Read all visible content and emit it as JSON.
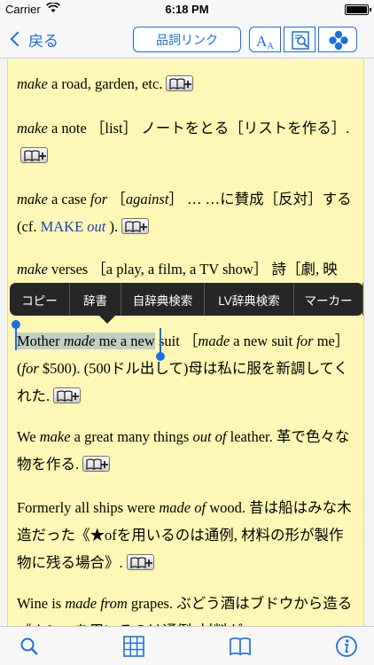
{
  "status_bar": {
    "carrier": "Carrier",
    "time": "6:18 PM"
  },
  "nav": {
    "back_label": "戻る",
    "pos_link_label": "品詞リンク",
    "font_icon": "font-size-icon",
    "search_icon": "search-in-page-icon",
    "menu_icon": "four-circles-icon"
  },
  "entries": {
    "e1": {
      "text": "a road, garden, etc.",
      "headword": "make"
    },
    "e2": {
      "headword": "make",
      "text": "a note ［list］ ノートをとる［リストを作る］."
    },
    "e3": {
      "headword": "make",
      "middle": "a case",
      "for": "for",
      "against": "against",
      "rest": "… …に賛成［反対］する (cf.",
      "ref": "MAKE",
      "ref_italic": "out",
      "end": ")."
    },
    "e4": {
      "headword": "make",
      "text": "verses ［a play, a film, a TV show］ 詩［劇, 映"
    },
    "e5": {
      "sel_start": "Mother",
      "sel_made": "made",
      "sel_rest": "me a new",
      "after_sel": "suit ［",
      "bracket_made": "made",
      "bracket_rest": "a new suit",
      "bracket_for": "for",
      "line2_start": "me］ (",
      "for2": "for",
      "line2_rest": "$500). (500ドル出して)母は私に服を新調してくれた."
    },
    "e6": {
      "start": "We",
      "make": "make",
      "mid": "a great many things",
      "outof": "out of",
      "end": "leather. 革で色々な物を作る."
    },
    "e7": {
      "start": "Formerly all ships were",
      "madeof": "made of",
      "end": "wood. 昔は船はみな木造だった《★ofを用いるのは通例, 材料の形が製作物に残る場合》."
    },
    "e8": {
      "start": "Wine is",
      "madefrom": "made from",
      "end": "grapes. ぶどう酒はブドウから造る《★fromを用いるのは通例, 材料が"
    }
  },
  "context_menu": {
    "items": [
      "コピー",
      "辞書",
      "自辞典検索",
      "LV辞典検索",
      "マーカー"
    ]
  },
  "tab_bar": {
    "icons": [
      "search-icon",
      "grid-icon",
      "book-icon",
      "info-icon"
    ]
  },
  "colors": {
    "accent": "#1a6fe0",
    "paper": "#fff7b5",
    "menu": "#262626",
    "ref": "#1a3fbf"
  }
}
